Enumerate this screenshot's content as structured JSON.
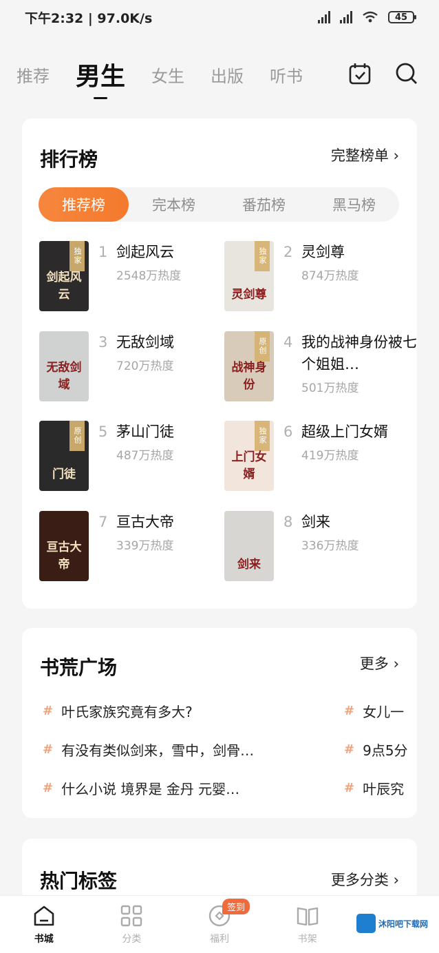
{
  "status_bar": {
    "time_speed": "下午2:32 | 97.0K/s",
    "battery": "45"
  },
  "channel_tabs": [
    "推荐",
    "男生",
    "女生",
    "出版",
    "听书"
  ],
  "ranking": {
    "title": "排行榜",
    "more": "完整榜单",
    "tabs": [
      "推荐榜",
      "完本榜",
      "番茄榜",
      "黑马榜"
    ],
    "books": [
      {
        "rank": "1",
        "name": "剑起风云",
        "heat": "2548万热度",
        "badge": "独家",
        "cover_text": "剑起风云",
        "cover_color": "#2c2a2a"
      },
      {
        "rank": "2",
        "name": "灵剑尊",
        "heat": "874万热度",
        "badge": "独家",
        "cover_text": "灵剑尊",
        "cover_color": "#e8e4de"
      },
      {
        "rank": "3",
        "name": "无敌剑域",
        "heat": "720万热度",
        "badge": "",
        "cover_text": "无敌剑域",
        "cover_color": "#cfd2d1"
      },
      {
        "rank": "4",
        "name": "我的战神身份被七个姐姐…",
        "heat": "501万热度",
        "badge": "原创",
        "cover_text": "战神身份",
        "cover_color": "#d9cbb9"
      },
      {
        "rank": "5",
        "name": "茅山门徒",
        "heat": "487万热度",
        "badge": "原创",
        "cover_text": "门徒",
        "cover_color": "#2a2a2a"
      },
      {
        "rank": "6",
        "name": "超级上门女婿",
        "heat": "419万热度",
        "badge": "独家",
        "cover_text": "上门女婿",
        "cover_color": "#f2e6dc"
      },
      {
        "rank": "7",
        "name": "亘古大帝",
        "heat": "339万热度",
        "badge": "",
        "cover_text": "亘古大帝",
        "cover_color": "#3a1d14"
      },
      {
        "rank": "8",
        "name": "剑来",
        "heat": "336万热度",
        "badge": "",
        "cover_text": "剑来",
        "cover_color": "#d8d6d2"
      }
    ]
  },
  "book_plaza": {
    "title": "书荒广场",
    "more": "更多",
    "topics": [
      "叶氏家族究竟有多大?",
      "女儿一",
      "有没有类似剑来，雪中，剑骨…",
      "9点5分",
      "什么小说 境界是 金丹 元婴…",
      "叶辰究"
    ]
  },
  "hot_tags": {
    "title": "热门标签",
    "more": "更多分类"
  },
  "bottom_nav": {
    "items": [
      "书城",
      "分类",
      "福利",
      "书架"
    ],
    "sign_badge": "签到"
  },
  "watermark": {
    "text": "沐阳吧下载网"
  },
  "colors": {
    "accent": "#f47a2c",
    "hash": "#f0a27a"
  }
}
